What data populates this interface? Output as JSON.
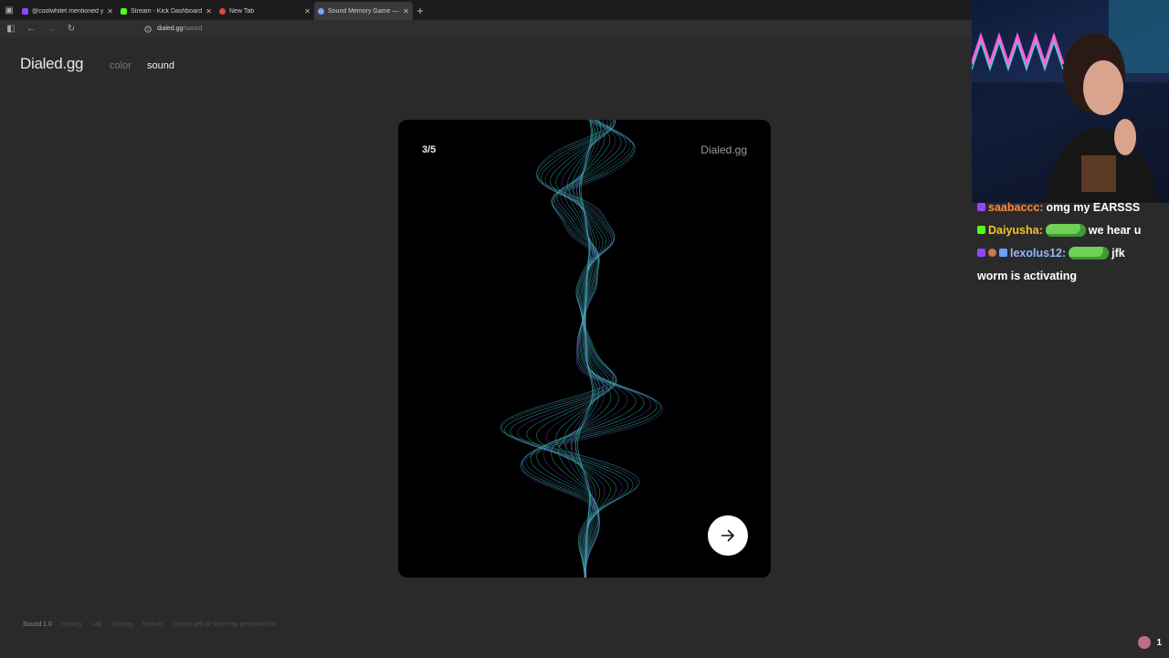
{
  "browser": {
    "tabs": [
      {
        "label": "@coolwhitet mentioned yo",
        "icon": "twitch-icon",
        "color": "#9146ff",
        "active": false
      },
      {
        "label": "Stream - Kick Dashboard",
        "icon": "kick-icon",
        "color": "#53fc18",
        "active": false
      },
      {
        "label": "New Tab",
        "icon": "chrome-icon",
        "color": "#e04a3a",
        "active": false
      },
      {
        "label": "Sound Memory Game — H",
        "icon": "dialed-icon",
        "color": "#7aa2ff",
        "active": true
      }
    ],
    "url_host": "dialed.gg",
    "url_path": "/sound"
  },
  "site": {
    "logo": "Dialed.gg",
    "nav": {
      "color": "color",
      "sound": "sound"
    },
    "card": {
      "counter": "3/5",
      "brand": "Dialed.gg",
      "next_icon": "arrow-right-icon"
    },
    "footer": [
      "Sound 1.0",
      "Privacy",
      "Lab",
      "Scoring",
      "Sounds",
      "Do not sell or share my personal info"
    ]
  },
  "stream": {
    "chat": [
      {
        "user": "saabaccc:",
        "user_color": "#ff8a3a",
        "parts": [
          "omg my EARSSS"
        ]
      },
      {
        "user": "Daiyusha:",
        "user_color": "#f2c230",
        "parts": [
          "we hear u"
        ]
      },
      {
        "user": "lexolus12:",
        "user_color": "#8fb8ff",
        "parts": [
          "jfk"
        ]
      },
      {
        "user": "",
        "user_color": "#ffffff",
        "parts": [
          "worm is activating"
        ]
      }
    ],
    "viewer_count": "1"
  },
  "colors": {
    "wave_teal": "#2fd3a6",
    "wave_purple": "#7b3fe0",
    "page_bg": "#2a2a2a"
  }
}
